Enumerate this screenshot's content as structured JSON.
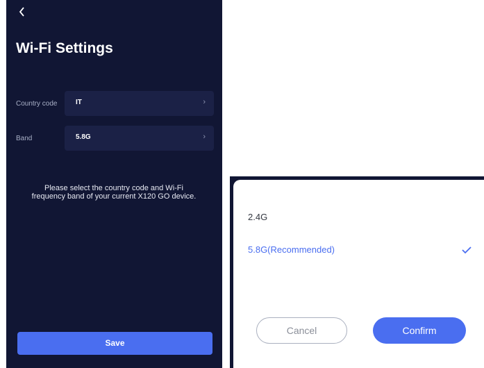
{
  "screen": {
    "back_icon": "chevron-left-icon",
    "title": "Wi-Fi Settings",
    "rows": [
      {
        "label": "Country code",
        "value": "IT"
      },
      {
        "label": "Band",
        "value": "5.8G"
      }
    ],
    "hint": "Please select the country code and Wi-Fi frequency band of your current X120 GO device.",
    "save_label": "Save"
  },
  "dialog": {
    "options": [
      {
        "label": "2.4G",
        "selected": false
      },
      {
        "label": "5.8G(Recommended)",
        "selected": true
      }
    ],
    "cancel_label": "Cancel",
    "confirm_label": "Confirm"
  },
  "colors": {
    "background": "#111634",
    "field": "#1b2146",
    "accent": "#4a6ef0"
  }
}
